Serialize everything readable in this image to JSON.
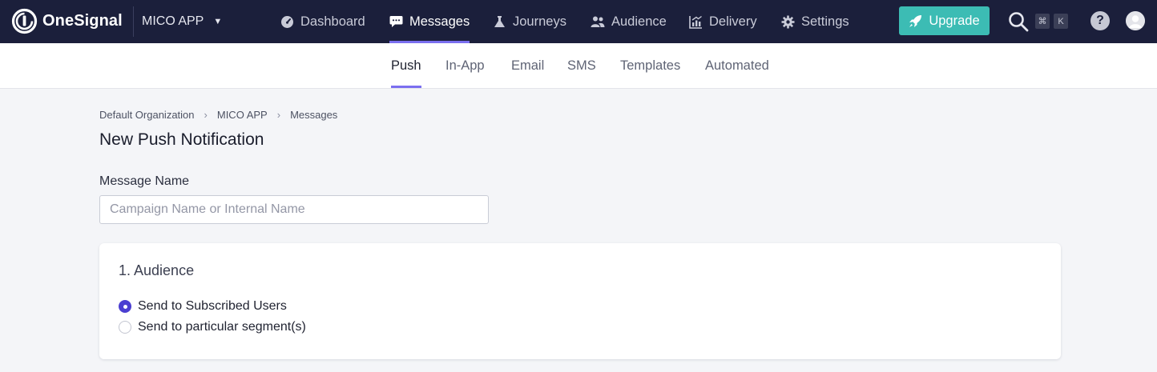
{
  "brand": {
    "name": "OneSignal"
  },
  "app_switcher": {
    "label": "MICO APP"
  },
  "nav": [
    {
      "label": "Dashboard",
      "icon": "dashboard-gauge-icon"
    },
    {
      "label": "Messages",
      "icon": "message-bubble-icon",
      "active": true
    },
    {
      "label": "Journeys",
      "icon": "journey-flask-icon"
    },
    {
      "label": "Audience",
      "icon": "users-icon"
    },
    {
      "label": "Delivery",
      "icon": "chart-icon"
    },
    {
      "label": "Settings",
      "icon": "gear-icon"
    }
  ],
  "upgrade": {
    "label": "Upgrade",
    "icon": "rocket-icon"
  },
  "search": {
    "shortcut_cmd": "⌘",
    "shortcut_key": "K"
  },
  "help": {
    "glyph": "?"
  },
  "subnav": [
    {
      "label": "Push",
      "active": true
    },
    {
      "label": "In-App"
    },
    {
      "label": "Email"
    },
    {
      "label": "SMS"
    },
    {
      "label": "Templates"
    },
    {
      "label": "Automated"
    }
  ],
  "breadcrumb": [
    "Default Organization",
    "MICO APP",
    "Messages"
  ],
  "breadcrumb_separator": "›",
  "page_title": "New Push Notification",
  "message_name": {
    "label": "Message Name",
    "placeholder": "Campaign Name or Internal Name",
    "value": ""
  },
  "audience": {
    "title": "1. Audience",
    "options": [
      {
        "label": "Send to Subscribed Users",
        "selected": true
      },
      {
        "label": "Send to particular segment(s)",
        "selected": false
      }
    ]
  },
  "colors": {
    "topbar": "#1b1f3b",
    "accent": "#7b6ff0",
    "upgrade": "#3cbcb4",
    "radio": "#4b3fd1"
  }
}
